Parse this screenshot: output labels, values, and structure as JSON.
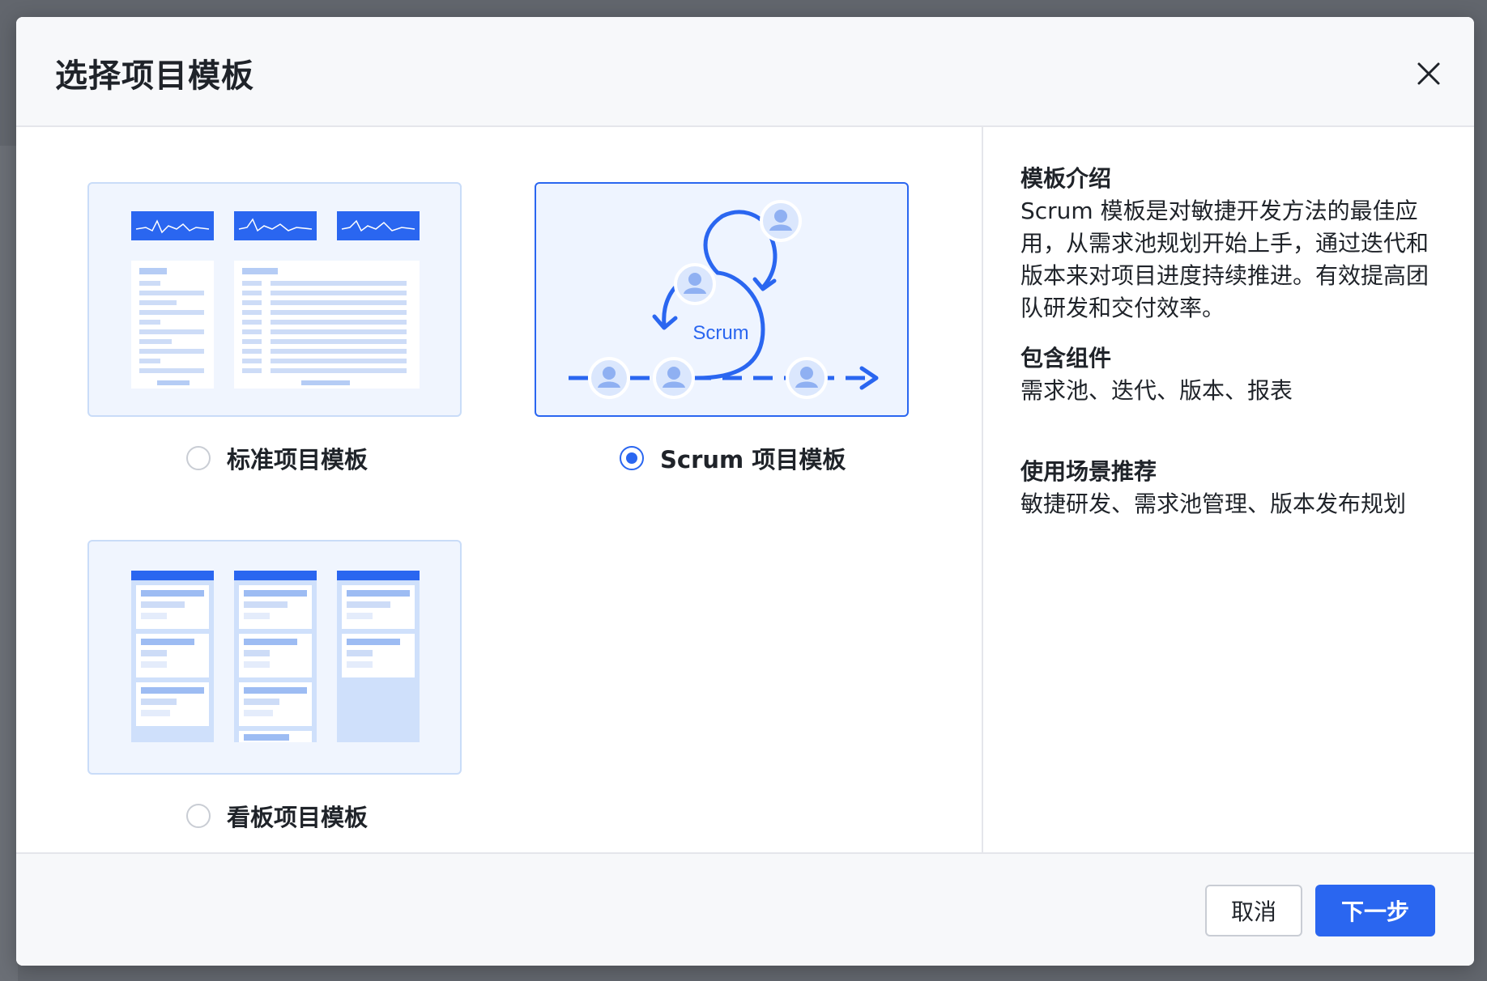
{
  "dialog": {
    "title": "选择项目模板"
  },
  "templates": [
    {
      "label": "标准项目模板",
      "selected": false
    },
    {
      "label": "Scrum 项目模板",
      "selected": true,
      "diagram_text": "Scrum"
    },
    {
      "label": "看板项目模板",
      "selected": false
    }
  ],
  "info": {
    "intro_heading": "模板介绍",
    "intro_text": "Scrum 模板是对敏捷开发方法的最佳应用，从需求池规划开始上手，通过迭代和版本来对项目进度持续推进。有效提高团队研发和交付效率。",
    "components_heading": "包含组件",
    "components_text": "需求池、迭代、版本、报表",
    "scenarios_heading": "使用场景推荐",
    "scenarios_text": "敏捷研发、需求池管理、版本发布规划"
  },
  "footer": {
    "cancel_label": "取消",
    "next_label": "下一步"
  },
  "colors": {
    "primary": "#2a66f0",
    "card_bg": "#f0f5fe",
    "card_border": "#c9dcf8"
  }
}
